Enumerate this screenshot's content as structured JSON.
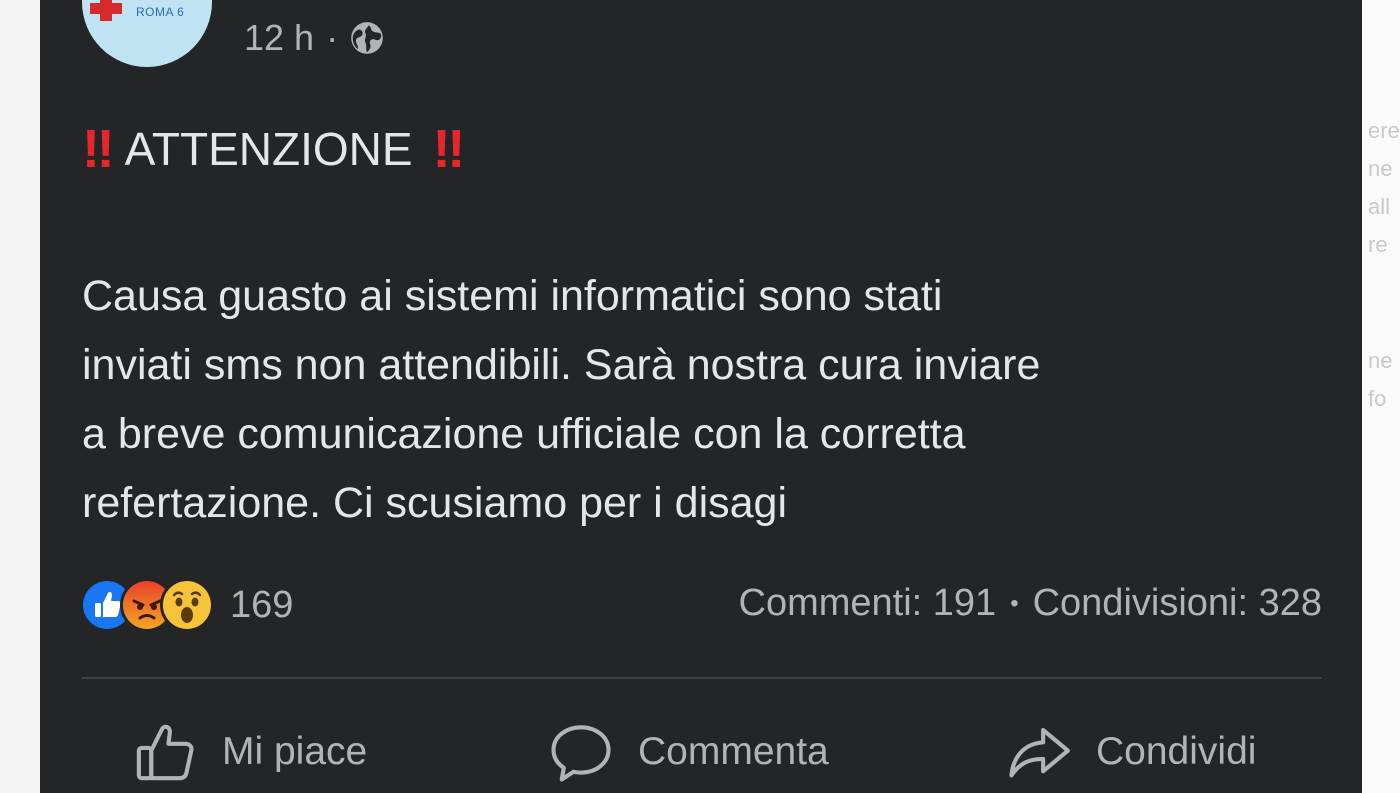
{
  "background_fragments": [
    "ere",
    "ne",
    "all",
    "re",
    "ne",
    "fo"
  ],
  "post": {
    "avatar_text": "ROMA 6",
    "time": "12 h",
    "time_separator": "·",
    "privacy_icon": "globe-icon",
    "headline_mark": "‼",
    "headline": "ATTENZIONE",
    "body_lines": [
      "Causa guasto ai sistemi informatici sono stati",
      "inviati sms non attendibili. Sarà nostra cura inviare",
      "a breve comunicazione ufficiale con la corretta",
      "refertazione. Ci scusiamo per i disagi"
    ],
    "reactions": {
      "icons": [
        "like-reaction-icon",
        "angry-reaction-icon",
        "wow-reaction-icon"
      ],
      "count": "169"
    },
    "stats": {
      "comments": "Commenti: 191",
      "separator": "•",
      "shares": "Condivisioni: 328"
    },
    "actions": {
      "like": "Mi piace",
      "comment": "Commenta",
      "share": "Condividi"
    }
  },
  "colors": {
    "card_background": "#242526",
    "primary_text": "#e4e6eb",
    "secondary_text": "#b0b3b8",
    "alert_red": "#e5262b",
    "like_blue": "#1877f2"
  }
}
